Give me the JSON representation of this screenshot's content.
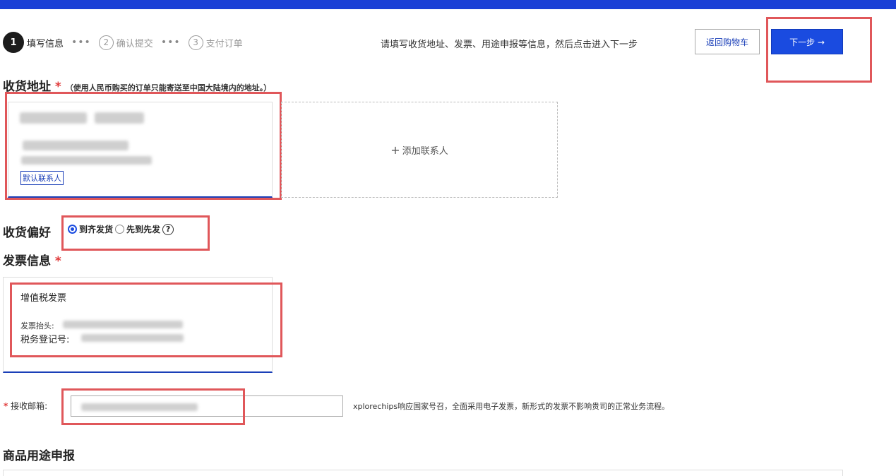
{
  "steps": [
    {
      "num": "1",
      "label": "填写信息"
    },
    {
      "num": "2",
      "label": "确认提交"
    },
    {
      "num": "3",
      "label": "支付订单"
    }
  ],
  "hint": "请填写收货地址、发票、用途申报等信息，然后点击进入下一步",
  "buttons": {
    "back": "返回购物车",
    "next": "下一步 →"
  },
  "address": {
    "title": "收货地址",
    "required": "*",
    "note": "（使用人民币购买的订单只能寄送至中国大陆境内的地址。）",
    "default_tag": "默认联系人",
    "add_contact": "添加联系人",
    "add_icon": "plus-icon"
  },
  "preference": {
    "title": "收货偏好",
    "option_all": "到齐发货",
    "option_first": "先到先发",
    "selected": "到齐发货",
    "help_icon": "question-circle-icon"
  },
  "invoice": {
    "title": "发票信息",
    "required": "*",
    "type": "增值税发票",
    "header_label": "发票抬头:",
    "tax_label": "税务登记号:"
  },
  "email": {
    "required": "*",
    "label": "接收邮箱:",
    "note": "xplorechips响应国家号召，全面采用电子发票，新形式的发票不影响贵司的正常业务流程。"
  },
  "usage": {
    "title": "商品用途申报"
  },
  "colors": {
    "topbar": "#1a3fd6",
    "primary": "#1a4be0",
    "highlight": "#e0575a",
    "required": "#e03a3a"
  }
}
